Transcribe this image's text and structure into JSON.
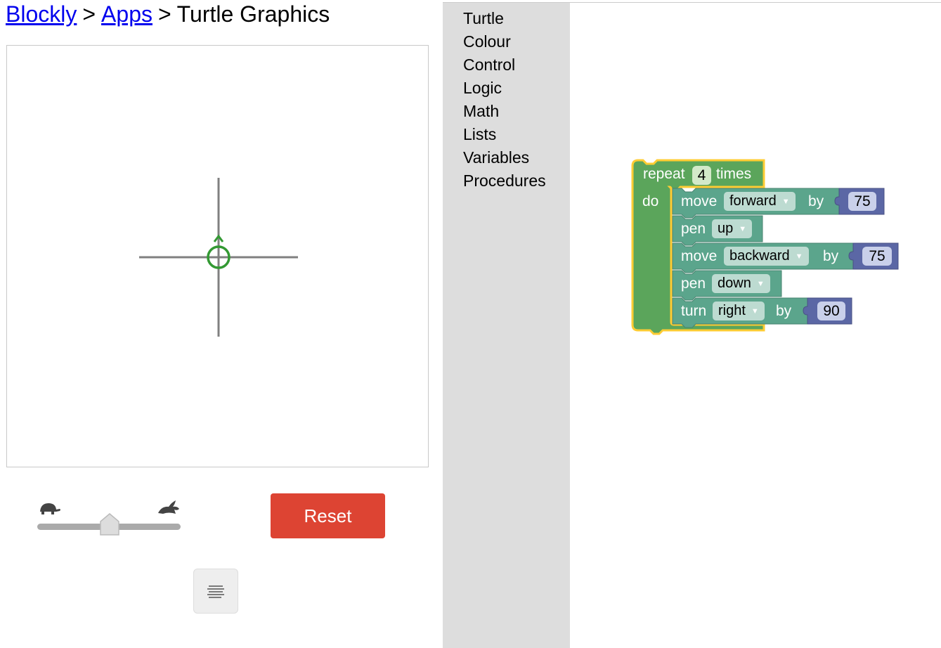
{
  "breadcrumb": {
    "link1": "Blockly",
    "sep1": ">",
    "link2": "Apps",
    "sep2": ">",
    "title": "Turtle Graphics"
  },
  "controls": {
    "reset_label": "Reset",
    "speed_level": 0.5
  },
  "toolbox": {
    "items": [
      "Turtle",
      "Colour",
      "Control",
      "Logic",
      "Math",
      "Lists",
      "Variables",
      "Procedures"
    ]
  },
  "blocks": {
    "repeat": {
      "kw1": "repeat",
      "count": "4",
      "kw2": "times",
      "do": "do"
    },
    "move1": {
      "kw": "move",
      "dir": "forward",
      "by": "by",
      "value": "75"
    },
    "pen1": {
      "kw": "pen",
      "state": "up"
    },
    "move2": {
      "kw": "move",
      "dir": "backward",
      "by": "by",
      "value": "75"
    },
    "pen2": {
      "kw": "pen",
      "state": "down"
    },
    "turn": {
      "kw": "turn",
      "dir": "right",
      "by": "by",
      "value": "90"
    }
  },
  "colors": {
    "control_block": "#5ba55b",
    "turtle_block": "#5ba58c",
    "math_block": "#5b67a5",
    "selection": "#fc3",
    "reset": "#dd4433",
    "toolbox_bg": "#ddd",
    "turtle": "#339933"
  },
  "icons": {
    "slow": "turtle-icon",
    "fast": "rabbit-icon",
    "code": "code-lines-icon",
    "dropdown": "dropdown-arrow-icon"
  }
}
